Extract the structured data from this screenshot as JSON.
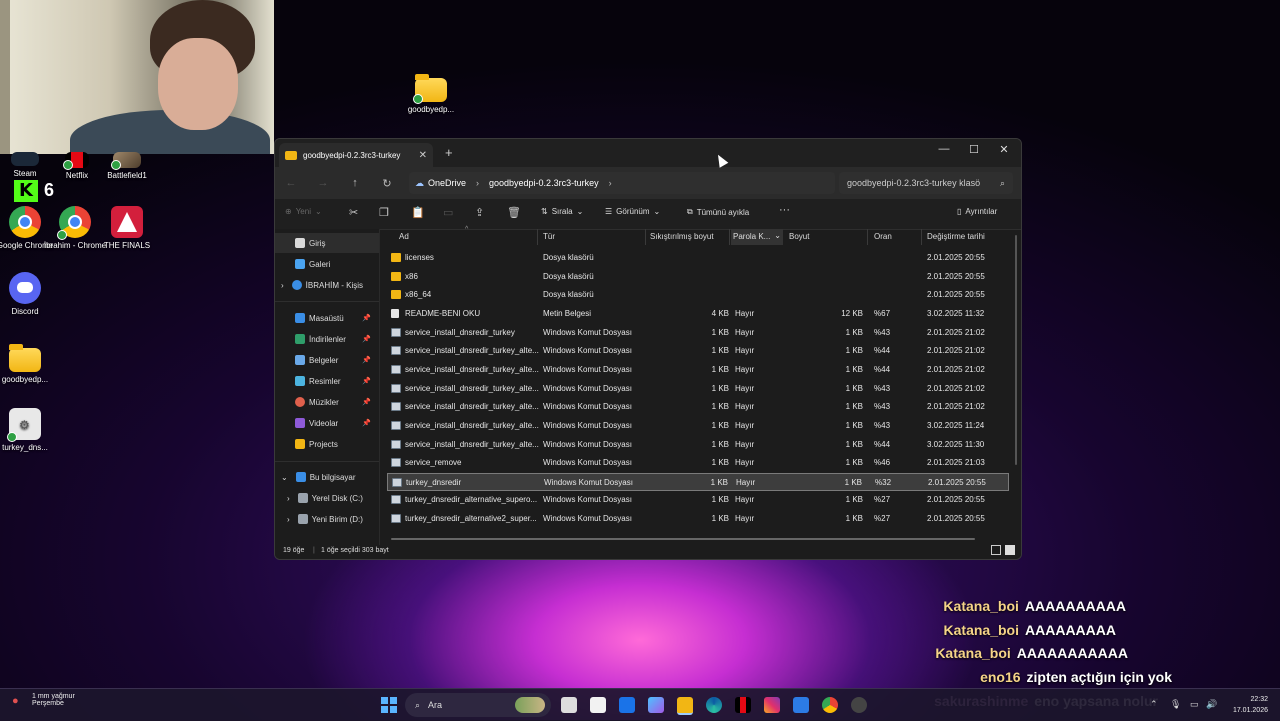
{
  "desktop": {
    "icons": [
      {
        "label": "Steam"
      },
      {
        "label": "Netflix"
      },
      {
        "label": "Battlefield1"
      },
      {
        "label": "Google Chrome"
      },
      {
        "label": "İbrahim - Chrome"
      },
      {
        "label": "THE FINALS"
      },
      {
        "label": "Discord"
      },
      {
        "label": "goodbyedp..."
      },
      {
        "label": "turkey_dns..."
      },
      {
        "label": "goodbyedp..."
      }
    ],
    "kick_count": "6"
  },
  "explorer": {
    "tab_title": "goodbyedpi-0.2.3rc3-turkey",
    "new_tab": "+",
    "window_controls": {
      "minimize": "—",
      "maximize": "☐",
      "close": "✕"
    },
    "breadcrumbs": [
      "OneDrive",
      "goodbyedpi-0.2.3rc3-turkey"
    ],
    "search_placeholder": "goodbyedpi-0.2.3rc3-turkey klasö",
    "toolbar": {
      "new_label": "Yeni",
      "sort_label": "Sırala",
      "view_label": "Görünüm",
      "select_none_label": "Tümünü ayıkla",
      "more_label": "···",
      "details_label": "Ayrıntılar"
    },
    "nav": {
      "home": "Giriş",
      "gallery": "Galeri",
      "onedrive": "İBRAHİM - Kişis",
      "pinned": [
        "Masaüstü",
        "İndirilenler",
        "Belgeler",
        "Resimler",
        "Müzikler",
        "Videolar",
        "Projects"
      ],
      "this_pc": "Bu bilgisayar",
      "drive_c": "Yerel Disk (C:)",
      "drive_d": "Yeni Birim (D:)"
    },
    "columns": {
      "name": "Ad",
      "type": "Tür",
      "compressed": "Sıkıştırılmış boyut",
      "password": "Parola K...",
      "size": "Boyut",
      "ratio": "Oran",
      "modified": "Değiştirme tarihi"
    },
    "files": [
      {
        "name": "licenses",
        "type": "Dosya klasörü",
        "compressed": "",
        "password": "",
        "size": "",
        "ratio": "",
        "modified": "2.01.2025 20:55",
        "icon": "folder"
      },
      {
        "name": "x86",
        "type": "Dosya klasörü",
        "compressed": "",
        "password": "",
        "size": "",
        "ratio": "",
        "modified": "2.01.2025 20:55",
        "icon": "folder"
      },
      {
        "name": "x86_64",
        "type": "Dosya klasörü",
        "compressed": "",
        "password": "",
        "size": "",
        "ratio": "",
        "modified": "2.01.2025 20:55",
        "icon": "folder"
      },
      {
        "name": "README-BENI OKU",
        "type": "Metin Belgesi",
        "compressed": "4 KB",
        "password": "Hayır",
        "size": "12 KB",
        "ratio": "%67",
        "modified": "3.02.2025 11:32",
        "icon": "txt"
      },
      {
        "name": "service_install_dnsredir_turkey",
        "type": "Windows Komut Dosyası",
        "compressed": "1 KB",
        "password": "Hayır",
        "size": "1 KB",
        "ratio": "%43",
        "modified": "2.01.2025 21:02",
        "icon": "cmd"
      },
      {
        "name": "service_install_dnsredir_turkey_alte...",
        "type": "Windows Komut Dosyası",
        "compressed": "1 KB",
        "password": "Hayır",
        "size": "1 KB",
        "ratio": "%44",
        "modified": "2.01.2025 21:02",
        "icon": "cmd"
      },
      {
        "name": "service_install_dnsredir_turkey_alte...",
        "type": "Windows Komut Dosyası",
        "compressed": "1 KB",
        "password": "Hayır",
        "size": "1 KB",
        "ratio": "%44",
        "modified": "2.01.2025 21:02",
        "icon": "cmd"
      },
      {
        "name": "service_install_dnsredir_turkey_alte...",
        "type": "Windows Komut Dosyası",
        "compressed": "1 KB",
        "password": "Hayır",
        "size": "1 KB",
        "ratio": "%43",
        "modified": "2.01.2025 21:02",
        "icon": "cmd"
      },
      {
        "name": "service_install_dnsredir_turkey_alte...",
        "type": "Windows Komut Dosyası",
        "compressed": "1 KB",
        "password": "Hayır",
        "size": "1 KB",
        "ratio": "%43",
        "modified": "2.01.2025 21:02",
        "icon": "cmd"
      },
      {
        "name": "service_install_dnsredir_turkey_alte...",
        "type": "Windows Komut Dosyası",
        "compressed": "1 KB",
        "password": "Hayır",
        "size": "1 KB",
        "ratio": "%43",
        "modified": "3.02.2025 11:24",
        "icon": "cmd"
      },
      {
        "name": "service_install_dnsredir_turkey_alte...",
        "type": "Windows Komut Dosyası",
        "compressed": "1 KB",
        "password": "Hayır",
        "size": "1 KB",
        "ratio": "%44",
        "modified": "3.02.2025 11:30",
        "icon": "cmd"
      },
      {
        "name": "service_remove",
        "type": "Windows Komut Dosyası",
        "compressed": "1 KB",
        "password": "Hayır",
        "size": "1 KB",
        "ratio": "%46",
        "modified": "2.01.2025 21:03",
        "icon": "cmd"
      },
      {
        "name": "turkey_dnsredir",
        "type": "Windows Komut Dosyası",
        "compressed": "1 KB",
        "password": "Hayır",
        "size": "1 KB",
        "ratio": "%32",
        "modified": "2.01.2025 20:55",
        "icon": "cmd",
        "selected": true
      },
      {
        "name": "turkey_dnsredir_alternative_supero...",
        "type": "Windows Komut Dosyası",
        "compressed": "1 KB",
        "password": "Hayır",
        "size": "1 KB",
        "ratio": "%27",
        "modified": "2.01.2025 20:55",
        "icon": "cmd"
      },
      {
        "name": "turkey_dnsredir_alternative2_super...",
        "type": "Windows Komut Dosyası",
        "compressed": "1 KB",
        "password": "Hayır",
        "size": "1 KB",
        "ratio": "%27",
        "modified": "2.01.2025 20:55",
        "icon": "cmd"
      }
    ],
    "status": {
      "count": "19 öğe",
      "selection": "1 öğe seçildi  303 bayt"
    }
  },
  "chat": [
    {
      "user": "Katana_boi",
      "msg": "AAAAAAAAAA",
      "color": "#f5d488"
    },
    {
      "user": "Katana_boi",
      "msg": "AAAAAAAAA",
      "color": "#f5d488"
    },
    {
      "user": "Katana_boi",
      "msg": "AAAAAAAAAAA",
      "color": "#f5d488"
    },
    {
      "user": "eno16",
      "msg": "zipten açtığın için yok",
      "color": "#f5d488"
    },
    {
      "user": "sakurashinme",
      "msg": "eno yapsana nolur",
      "color": "#e8b6f0"
    }
  ],
  "taskbar": {
    "weather_temp": "1 mm yağmur",
    "weather_day": "Perşembe",
    "search_placeholder": "Ara",
    "time": "22:32",
    "date": "17.01.2026"
  }
}
